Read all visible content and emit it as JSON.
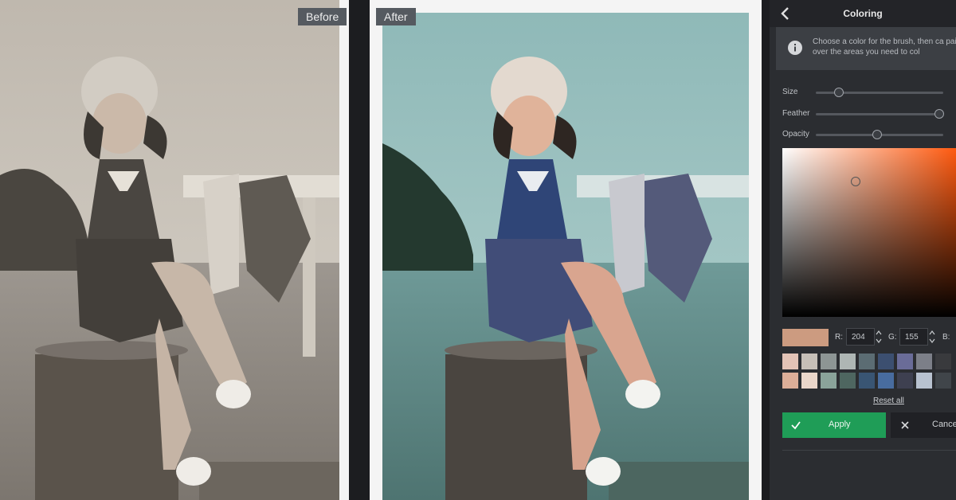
{
  "before_label": "Before",
  "after_label": "After",
  "panel": {
    "title": "Coloring",
    "info_text": "Choose a color for the brush, then ca paint over the areas you need to col",
    "sliders": [
      {
        "label": "Size",
        "value": 0.18
      },
      {
        "label": "Feather",
        "value": 0.97
      },
      {
        "label": "Opacity",
        "value": 0.48
      }
    ],
    "current_color": "#cc9b80",
    "rgb": {
      "r_label": "R:",
      "r_value": "204",
      "g_label": "G:",
      "g_value": "155",
      "b_label": "B:"
    },
    "swatches_row1": [
      "#e3c3b6",
      "#c6bfb7",
      "#8d9594",
      "#aeb6b4",
      "#5b6c73",
      "#3c4f70",
      "#6a6c98",
      "#7c7f88",
      "#393a3d"
    ],
    "swatches_row2": [
      "#dcae98",
      "#ead6ca",
      "#8aa39a",
      "#4e6660",
      "#395573",
      "#486c9f",
      "#3e4050",
      "#b8c2d0",
      "#40454a"
    ],
    "reset_label": "Reset all",
    "apply_label": "Apply",
    "cancel_label": "Cance"
  }
}
